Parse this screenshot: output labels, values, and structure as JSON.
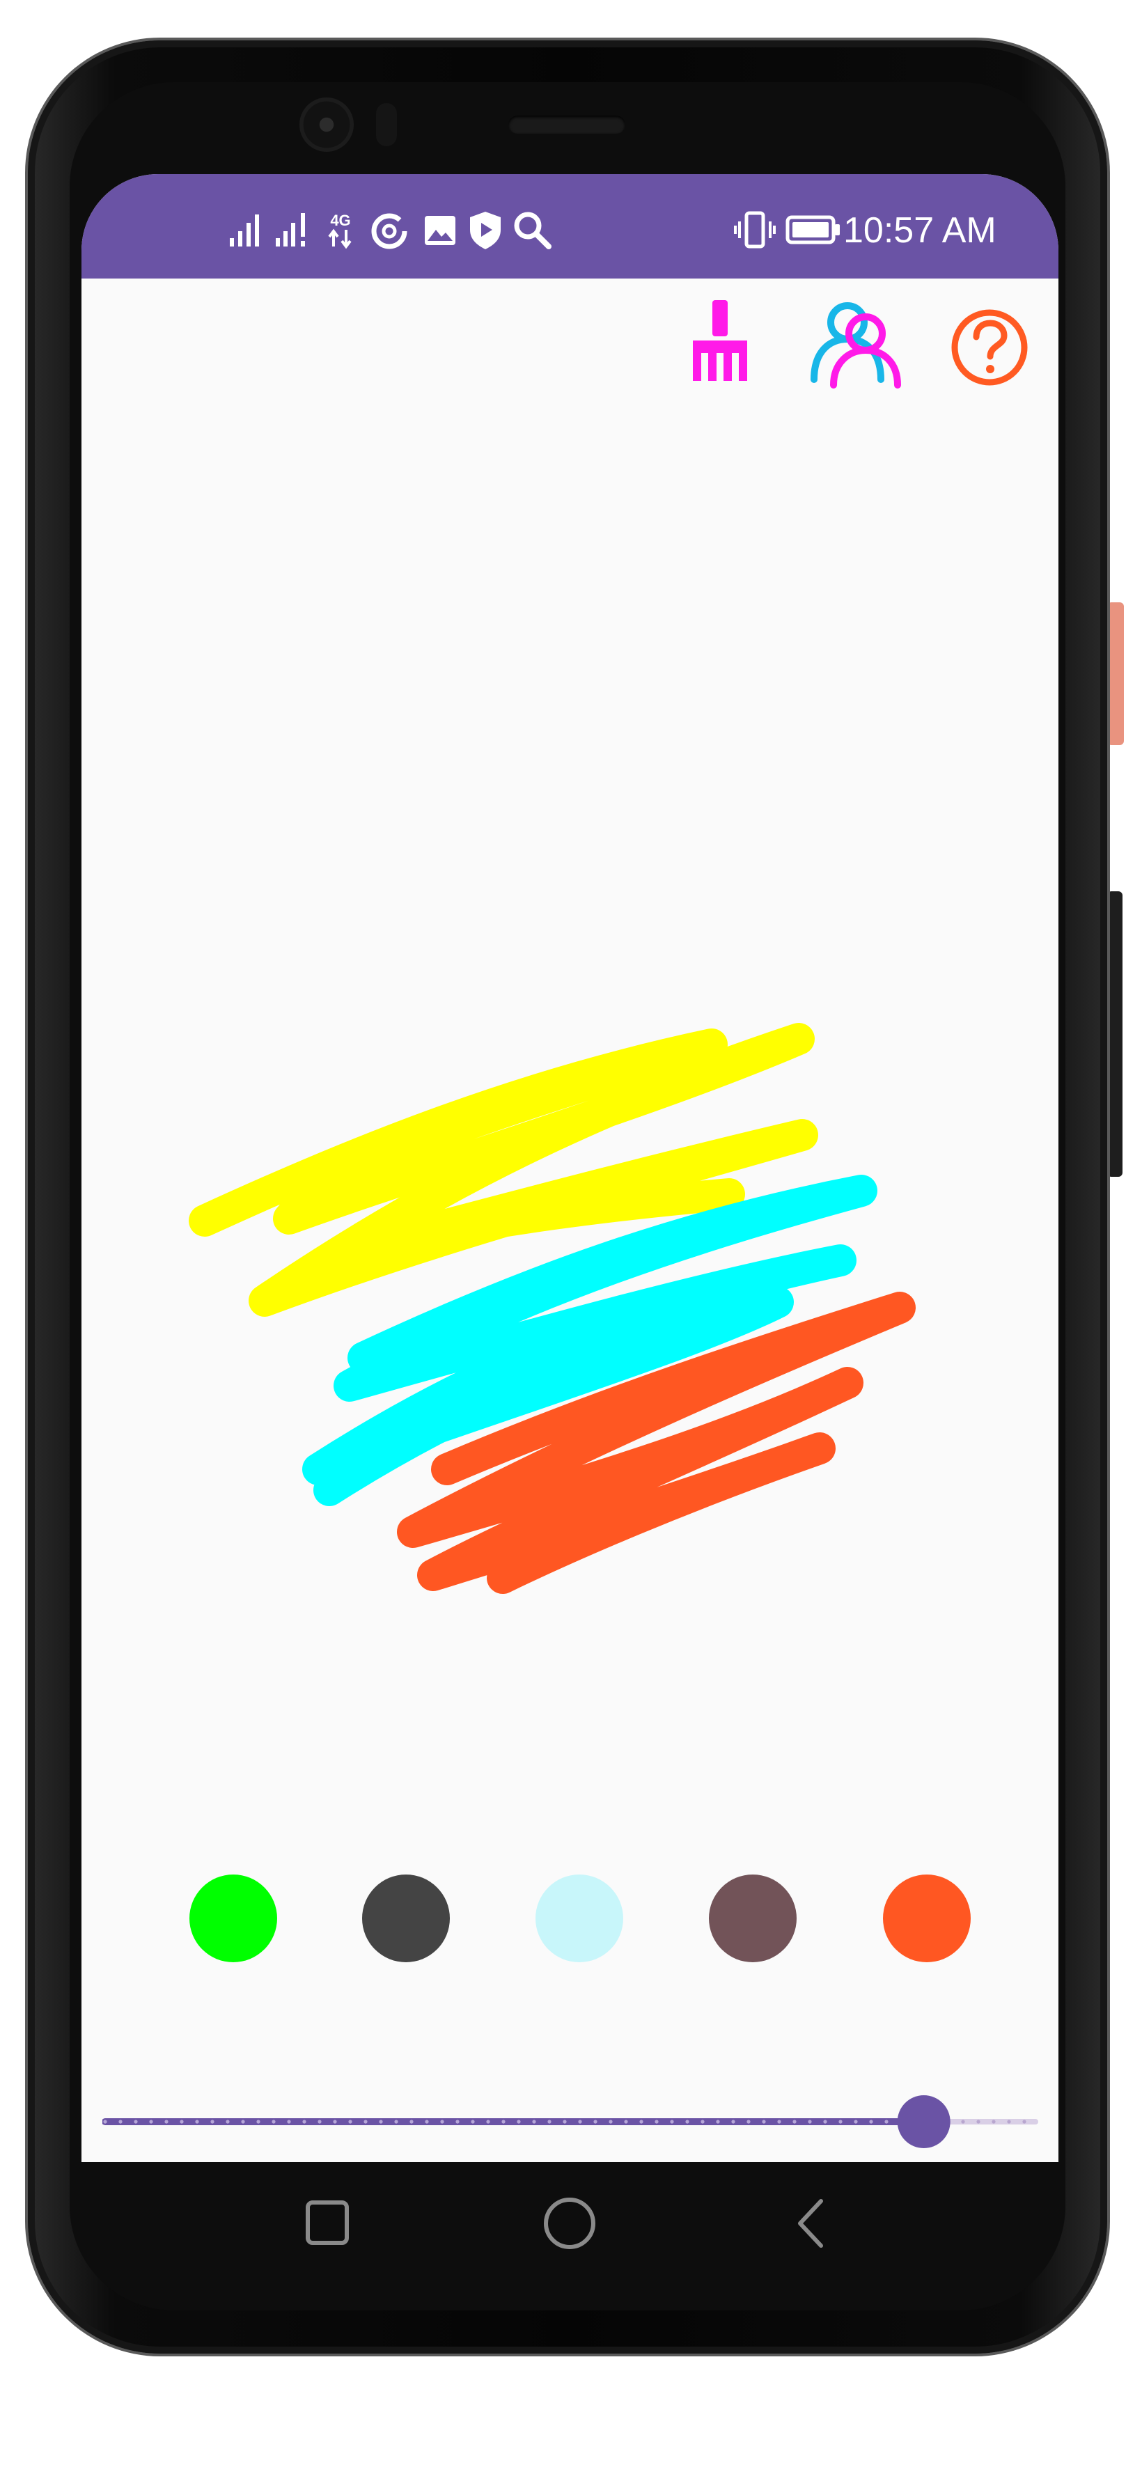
{
  "status_bar": {
    "time": "10:57 AM",
    "left_icons": [
      "signal-icon",
      "signal-alert-icon",
      "network-4g-icon",
      "data-saver-icon",
      "image-icon",
      "shield-play-icon",
      "search-icon"
    ],
    "right_icons": [
      "vibrate-icon",
      "battery-icon"
    ],
    "network_label": "4G"
  },
  "toolbar": {
    "icons": [
      "broom-clear-icon",
      "collaborate-users-icon",
      "help-icon"
    ],
    "colors": {
      "broom": "#ff1ae8",
      "users_a": "#18b6e8",
      "users_b": "#ff1ae8",
      "help": "#ff5a22"
    }
  },
  "canvas": {
    "background": "#fafafa",
    "strokes": [
      {
        "color": "#ffff00",
        "name": "yellow-stroke"
      },
      {
        "color": "#00ffff",
        "name": "cyan-stroke"
      },
      {
        "color": "#ff5722",
        "name": "orange-stroke"
      }
    ]
  },
  "palette": {
    "colors": [
      "#00ff00",
      "#444444",
      "#c8f6fa",
      "#725358",
      "#ff5722"
    ]
  },
  "brush_size": {
    "value_fraction": 0.88,
    "track_color": "#6a53a5",
    "inactive_color": "#d9cfe6"
  },
  "nav_bar": {
    "buttons": [
      "recent-apps-button",
      "home-button",
      "back-button"
    ]
  }
}
